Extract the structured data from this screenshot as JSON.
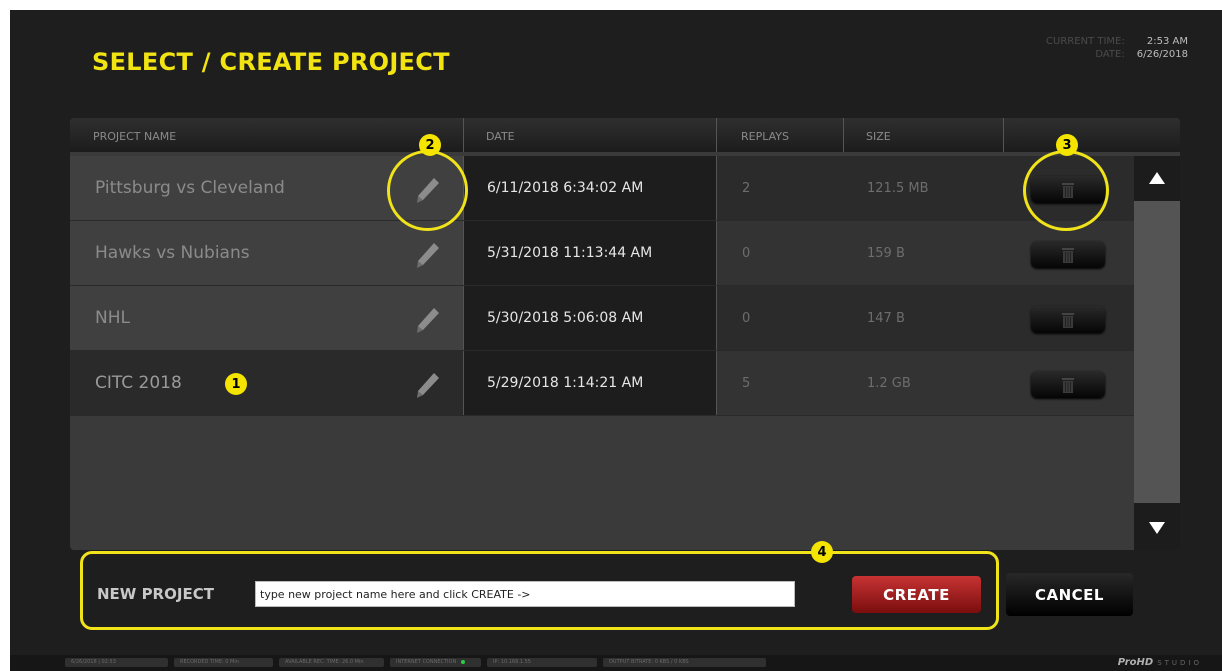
{
  "header": {
    "title": "SELECT / CREATE PROJECT",
    "current_time_label": "CURRENT TIME:",
    "current_time": "2:53 AM",
    "date_label": "DATE:",
    "date": "6/26/2018"
  },
  "table": {
    "columns": {
      "name": "PROJECT NAME",
      "date": "DATE",
      "replays": "REPLAYS",
      "size": "SIZE"
    },
    "rows": [
      {
        "name": "Pittsburg  vs  Cleveland",
        "date": "6/11/2018 6:34:02 AM",
        "replays": "2",
        "size": "121.5 MB"
      },
      {
        "name": "Hawks  vs Nubians",
        "date": "5/31/2018 11:13:44 AM",
        "replays": "0",
        "size": "159 B"
      },
      {
        "name": "NHL",
        "date": "5/30/2018 5:06:08 AM",
        "replays": "0",
        "size": "147 B"
      },
      {
        "name": "CITC 2018",
        "date": "5/29/2018 1:14:21 AM",
        "replays": "5",
        "size": "1.2 GB"
      }
    ]
  },
  "new_project": {
    "label": "NEW PROJECT",
    "placeholder": "type new project name here and click CREATE ->",
    "create_label": "CREATE",
    "cancel_label": "CANCEL"
  },
  "callouts": [
    "1",
    "2",
    "3",
    "4"
  ],
  "statusbar": {
    "items": [
      "6/26/2018 | 02:53",
      "RECORDED TIME: 0 Min",
      "AVAILABLE REC. TIME: 26.0 Min",
      "INTERNET CONNECTION",
      "IP: 10.168.1.55",
      "OUTPUT BITRATE: 0 KBS / 0 KBS"
    ],
    "brand": "ProHD",
    "brand_sub": "STUDIO"
  },
  "colors": {
    "accent_yellow": "#f2e312",
    "create_red": "#c73333",
    "background": "#1e1e1e"
  },
  "icons": [
    "pencil-icon",
    "trash-icon",
    "arrow-up-icon",
    "arrow-down-icon"
  ]
}
